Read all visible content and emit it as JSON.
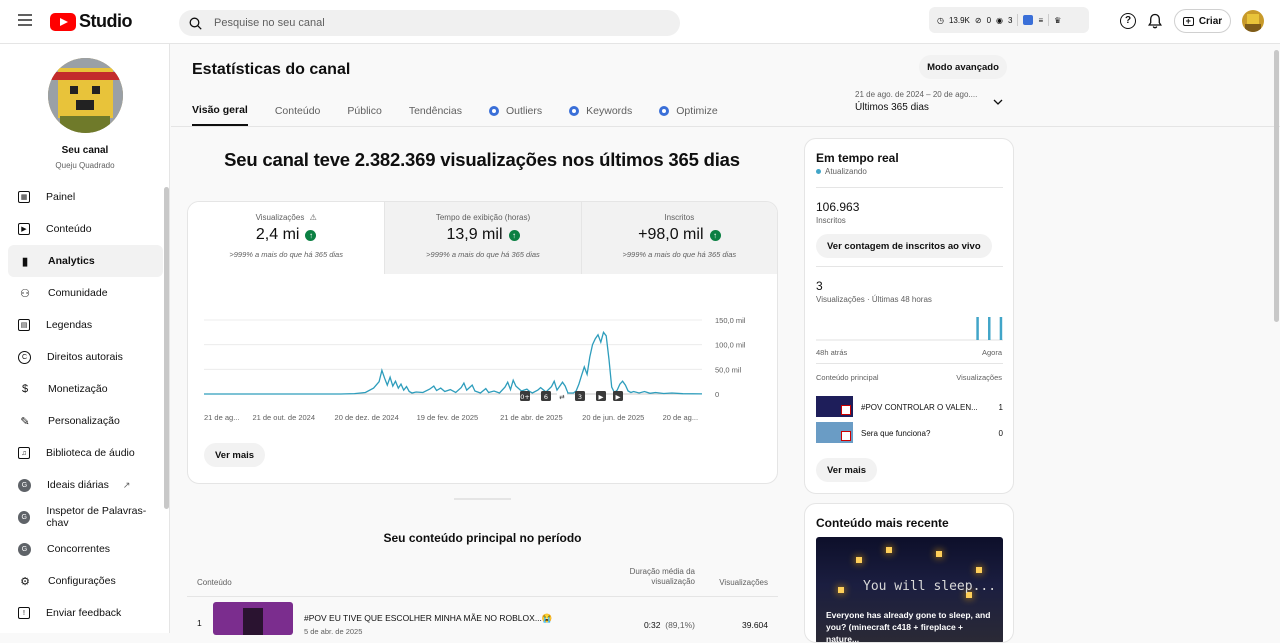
{
  "header": {
    "logo_text": "Studio",
    "search_placeholder": "Pesquise no seu canal",
    "ext_views": "13.9K",
    "ext_a": "0",
    "ext_b": "3",
    "create_label": "Criar"
  },
  "sidebar": {
    "channel_title": "Seu canal",
    "channel_name": "Queju Quadrado",
    "items": [
      {
        "label": "Painel",
        "icon": "dashboard-icon",
        "glyph": "▦"
      },
      {
        "label": "Conteúdo",
        "icon": "content-icon",
        "glyph": "▶"
      },
      {
        "label": "Analytics",
        "icon": "analytics-icon",
        "glyph": "▮"
      },
      {
        "label": "Comunidade",
        "icon": "community-icon",
        "glyph": "⚇"
      },
      {
        "label": "Legendas",
        "icon": "subtitles-icon",
        "glyph": "▤"
      },
      {
        "label": "Direitos autorais",
        "icon": "copyright-icon",
        "glyph": "C"
      },
      {
        "label": "Monetização",
        "icon": "monetization-icon",
        "glyph": "$"
      },
      {
        "label": "Personalização",
        "icon": "customization-icon",
        "glyph": "✎"
      },
      {
        "label": "Biblioteca de áudio",
        "icon": "audio-library-icon",
        "glyph": "♫"
      },
      {
        "label": "Ideais diárias",
        "icon": "extension-icon",
        "glyph": "G"
      },
      {
        "label": "Inspetor de Palavras-chav",
        "icon": "extension-icon",
        "glyph": "G"
      },
      {
        "label": "Concorrentes",
        "icon": "extension-icon",
        "glyph": "G"
      },
      {
        "label": "Configurações",
        "icon": "settings-icon",
        "glyph": "⚙"
      },
      {
        "label": "Enviar feedback",
        "icon": "feedback-icon",
        "glyph": "!"
      }
    ]
  },
  "page": {
    "title": "Estatísticas do canal",
    "advanced_button": "Modo avançado",
    "tabs": [
      {
        "label": "Visão geral",
        "ext": false
      },
      {
        "label": "Conteúdo",
        "ext": false
      },
      {
        "label": "Público",
        "ext": false
      },
      {
        "label": "Tendências",
        "ext": false
      },
      {
        "label": "Outliers",
        "ext": true
      },
      {
        "label": "Keywords",
        "ext": true
      },
      {
        "label": "Optimize",
        "ext": true
      }
    ],
    "date_range": "21 de ago. de 2024 – 20 de ago....",
    "date_label": "Últimos 365 dias"
  },
  "overview": {
    "headline": "Seu canal teve 2.382.369 visualizações nos últimos 365 dias",
    "metrics": [
      {
        "label": "Visualizações",
        "value": "2,4 mi",
        "comparison": ">999% a mais do que há 365 dias"
      },
      {
        "label": "Tempo de exibição (horas)",
        "value": "13,9 mil",
        "comparison": ">999% a mais do que há 365 dias"
      },
      {
        "label": "Inscritos",
        "value": "+98,0 mil",
        "comparison": ">999% a mais do que há 365 dias"
      }
    ],
    "see_more": "Ver mais"
  },
  "chart_data": {
    "type": "line",
    "title": "",
    "ylabel": "",
    "ylim": [
      0,
      150000
    ],
    "y_ticks": [
      "150,0 mil",
      "100,0 mil",
      "50,0 mil",
      "0"
    ],
    "x_ticks": [
      "21 de ag...",
      "21 de out. de 2024",
      "20 de dez. de 2024",
      "19 de fev. de 2025",
      "21 de abr. de 2025",
      "20 de jun. de 2025",
      "20 de ag..."
    ],
    "x_start": "2024-08-21",
    "x_end": "2025-08-20",
    "series": [
      {
        "name": "",
        "values": [
          0,
          0,
          0,
          0,
          0,
          0,
          0,
          0,
          0,
          0,
          0,
          0,
          0,
          0,
          0,
          0,
          0,
          0,
          0,
          0,
          0,
          0,
          0,
          0,
          0,
          0,
          0,
          0,
          0,
          0,
          0,
          0,
          0,
          0,
          0,
          0,
          0,
          0,
          0,
          0,
          0,
          0,
          0,
          0,
          0,
          0,
          0,
          0,
          0,
          0,
          0,
          0,
          0,
          0,
          0,
          0,
          0,
          0,
          0,
          0,
          0,
          0,
          0,
          0,
          0,
          0,
          0,
          0,
          0,
          0,
          0,
          0,
          0,
          0,
          0,
          0,
          0,
          0,
          0,
          0,
          0,
          0,
          0,
          0,
          0,
          0,
          0,
          0,
          0,
          0,
          0,
          0,
          0,
          0,
          0,
          0,
          0,
          0,
          0,
          0,
          0,
          0,
          0,
          0,
          0,
          0,
          0,
          0,
          0,
          0,
          0,
          0,
          0,
          0,
          0,
          0,
          0,
          0,
          0,
          0,
          0,
          0,
          0,
          0,
          0,
          0,
          0,
          0,
          0,
          0,
          0,
          0,
          0,
          0,
          0,
          0,
          0,
          0,
          0,
          0,
          0,
          0,
          0,
          0,
          0,
          0,
          0,
          0,
          0,
          0,
          0,
          0,
          0,
          0,
          0,
          0,
          0,
          0,
          0,
          0,
          0,
          0,
          0,
          0,
          0,
          0,
          0,
          0,
          0,
          0,
          0,
          0,
          0,
          0,
          0,
          0,
          0,
          0,
          0,
          0,
          0,
          0,
          0,
          0,
          0,
          0,
          0,
          0,
          0,
          0,
          0,
          0,
          0,
          0,
          0,
          0,
          0,
          0,
          0,
          0,
          0,
          0,
          0,
          0,
          0,
          0,
          0,
          0,
          0,
          0,
          0,
          0,
          0,
          0,
          0,
          0,
          0,
          0,
          0,
          0,
          0,
          0,
          0,
          0,
          0,
          0,
          0,
          0,
          0,
          0,
          0,
          0,
          0,
          0,
          0,
          0,
          0,
          0,
          0,
          0,
          0,
          0,
          0,
          0,
          0,
          0,
          0,
          0,
          0,
          0,
          0,
          0,
          0,
          0,
          0,
          0,
          0,
          0,
          0,
          0,
          0,
          0,
          0,
          0,
          0,
          0,
          0,
          0,
          0,
          0,
          0,
          0,
          0,
          0,
          0,
          0,
          0,
          0,
          0,
          0,
          0,
          0,
          0,
          0,
          0,
          0,
          0,
          0,
          0,
          0,
          0,
          0,
          0,
          0,
          0,
          0,
          0,
          0,
          0,
          0,
          0,
          0,
          0,
          0,
          0,
          0,
          0,
          0,
          0,
          0,
          0,
          0,
          0,
          0,
          0,
          0,
          0,
          0,
          0,
          0,
          0,
          0,
          0,
          0,
          0,
          0,
          0,
          0,
          0,
          0,
          0,
          0,
          0,
          0,
          0,
          0,
          0,
          0,
          0,
          0,
          0,
          0,
          0,
          0,
          0,
          0,
          0,
          0,
          0,
          0,
          0,
          0,
          0,
          0,
          0,
          0,
          0,
          0,
          0,
          0,
          0,
          0,
          0,
          0,
          0,
          0,
          0,
          0,
          0,
          0,
          0,
          0,
          0,
          0,
          0,
          0,
          0,
          0,
          0,
          0,
          0,
          0
        ]
      }
    ],
    "points": [
      [
        0,
        0
      ],
      [
        40,
        0
      ],
      [
        80,
        0
      ],
      [
        100,
        0
      ],
      [
        110,
        800
      ],
      [
        118,
        3000
      ],
      [
        124,
        12000
      ],
      [
        128,
        25000
      ],
      [
        130,
        48000
      ],
      [
        132,
        32000
      ],
      [
        134,
        18000
      ],
      [
        136,
        34000
      ],
      [
        138,
        16000
      ],
      [
        140,
        26000
      ],
      [
        142,
        12000
      ],
      [
        144,
        20000
      ],
      [
        146,
        8000
      ],
      [
        148,
        15000
      ],
      [
        150,
        5000
      ],
      [
        152,
        2000
      ],
      [
        155,
        4000
      ],
      [
        160,
        3000
      ],
      [
        165,
        10000
      ],
      [
        168,
        16000
      ],
      [
        170,
        7000
      ],
      [
        173,
        12000
      ],
      [
        176,
        5000
      ],
      [
        180,
        9000
      ],
      [
        184,
        3000
      ],
      [
        188,
        13000
      ],
      [
        190,
        22000
      ],
      [
        192,
        8000
      ],
      [
        196,
        18000
      ],
      [
        198,
        6000
      ],
      [
        202,
        2000
      ],
      [
        206,
        11000
      ],
      [
        208,
        3000
      ],
      [
        212,
        6000
      ],
      [
        216,
        2000
      ],
      [
        220,
        14000
      ],
      [
        222,
        24000
      ],
      [
        224,
        9000
      ],
      [
        226,
        28000
      ],
      [
        228,
        16000
      ],
      [
        232,
        6000
      ],
      [
        236,
        10000
      ],
      [
        238,
        5000
      ],
      [
        240,
        2000
      ],
      [
        244,
        8000
      ],
      [
        246,
        13000
      ],
      [
        250,
        4000
      ],
      [
        254,
        15000
      ],
      [
        256,
        26000
      ],
      [
        258,
        8000
      ],
      [
        262,
        24000
      ],
      [
        264,
        16000
      ],
      [
        266,
        2000
      ],
      [
        270,
        2000
      ],
      [
        272,
        6000
      ],
      [
        274,
        20000
      ],
      [
        276,
        38000
      ],
      [
        278,
        55000
      ],
      [
        280,
        40000
      ],
      [
        282,
        75000
      ],
      [
        284,
        100000
      ],
      [
        286,
        112000
      ],
      [
        288,
        120000
      ],
      [
        290,
        105000
      ],
      [
        292,
        125000
      ],
      [
        294,
        118000
      ],
      [
        296,
        70000
      ],
      [
        298,
        14000
      ],
      [
        300,
        3000
      ],
      [
        302,
        8000
      ],
      [
        304,
        20000
      ],
      [
        306,
        26000
      ],
      [
        308,
        18000
      ],
      [
        310,
        6000
      ],
      [
        312,
        3000
      ],
      [
        314,
        5000
      ],
      [
        318,
        2000
      ],
      [
        322,
        5000
      ],
      [
        326,
        1500
      ],
      [
        330,
        3000
      ],
      [
        336,
        1000
      ],
      [
        342,
        2000
      ],
      [
        350,
        600
      ],
      [
        364,
        300
      ]
    ],
    "annotation_markers": [
      "0+",
      "6",
      "⇄",
      "3",
      "▶",
      "▶"
    ]
  },
  "realtime": {
    "title": "Em tempo real",
    "updating": "Atualizando",
    "subscribers": "106.963",
    "subscribers_label": "Inscritos",
    "live_count_button": "Ver contagem de inscritos ao vivo",
    "views": "3",
    "views_label": "Visualizações · Últimas 48 horas",
    "axis_start": "48h atrás",
    "axis_end": "Agora",
    "top_content_label": "Conteúdo principal",
    "views_col_label": "Visualizações",
    "hourly_views": [
      0,
      0,
      0,
      0,
      0,
      0,
      0,
      0,
      0,
      0,
      0,
      0,
      0,
      0,
      0,
      0,
      0,
      0,
      0,
      0,
      0,
      0,
      0,
      0,
      0,
      0,
      0,
      0,
      0,
      0,
      0,
      0,
      0,
      0,
      0,
      0,
      0,
      0,
      0,
      0,
      0,
      1,
      0,
      0,
      1,
      0,
      0,
      1
    ],
    "items": [
      {
        "title": "#POV CONTROLAR O VALEN...",
        "views": "1"
      },
      {
        "title": "Sera que funciona?",
        "views": "0"
      }
    ],
    "see_more": "Ver mais"
  },
  "recent": {
    "title": "Conteúdo mais recente",
    "thumb_text": "You will sleep...",
    "video_title": "Everyone has already gone to sleep, and you? (minecraft c418 + fireplace + nature..."
  },
  "top_content": {
    "title": "Seu conteúdo principal no período",
    "col_content": "Conteúdo",
    "col_duration": "Duração média da visualização",
    "col_views": "Visualizações",
    "rows": [
      {
        "rank": "1",
        "title": "#POV EU TIVE QUE ESCOLHER MINHA MÃE NO ROBLOX...😭",
        "date": "5 de abr. de 2025",
        "duration": "0:32",
        "duration_pct": "(89,1%)",
        "views": "39.604"
      }
    ]
  }
}
